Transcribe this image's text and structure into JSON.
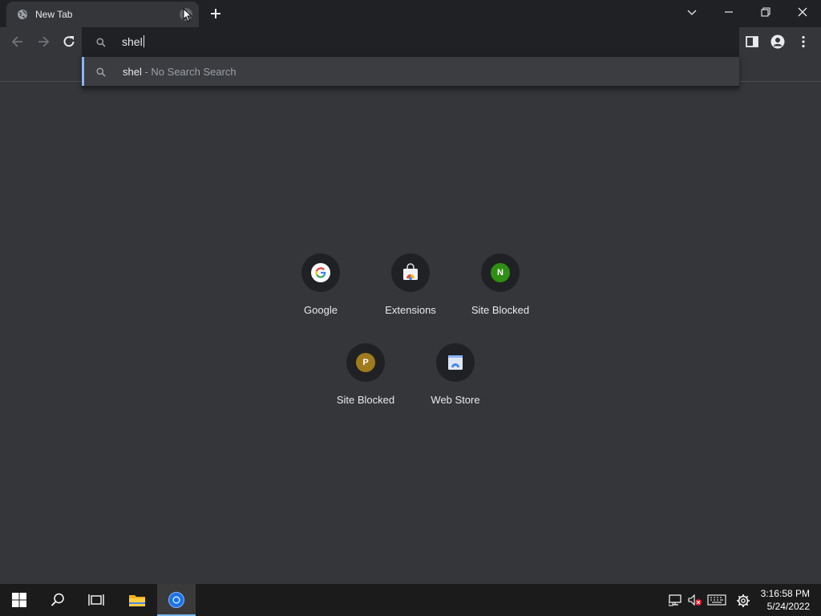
{
  "tab": {
    "title": "New Tab"
  },
  "omnibox": {
    "text": "shel"
  },
  "suggestion": {
    "query": "shel",
    "separator": " - ",
    "description": "No Search Search"
  },
  "shortcuts": [
    {
      "label": "Google"
    },
    {
      "label": "Extensions"
    },
    {
      "label": "Site Blocked",
      "letter": "N",
      "color": "#2f8f14"
    },
    {
      "label": "Site Blocked",
      "letter": "P",
      "color": "#a07b1e"
    },
    {
      "label": "Web Store"
    }
  ],
  "taskbar": {
    "time": "3:16:58 PM",
    "date": "5/24/2022"
  },
  "colors": {
    "accent": "#8ab4f8",
    "background": "#35363a",
    "chrome_dark": "#202124"
  }
}
